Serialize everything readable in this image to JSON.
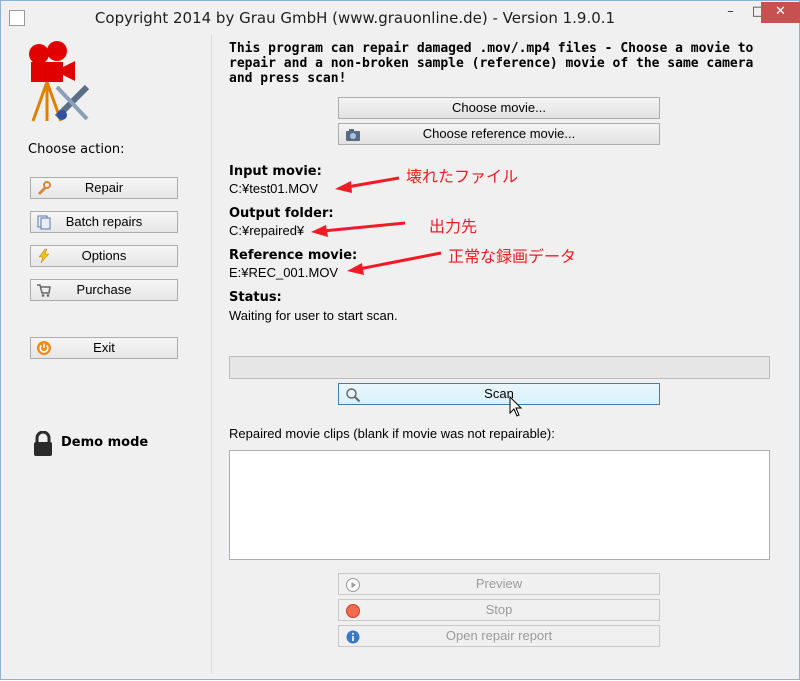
{
  "window": {
    "title": "Copyright 2014 by Grau GmbH (www.grauonline.de) - Version 1.9.0.1",
    "controls": {
      "minimize": "–",
      "maximize": "□",
      "close": "✕"
    }
  },
  "sidebar": {
    "choose_label": "Choose action:",
    "items": [
      {
        "label": "Repair",
        "icon": "wrench-icon"
      },
      {
        "label": "Batch repairs",
        "icon": "pages-icon"
      },
      {
        "label": "Options",
        "icon": "lightning-icon"
      },
      {
        "label": "Purchase",
        "icon": "cart-icon"
      },
      {
        "label": "Exit",
        "icon": "power-icon"
      }
    ],
    "demo_mode": "Demo mode"
  },
  "main": {
    "intro": "This program can repair damaged .mov/.mp4 files - Choose a movie to repair and a non-broken sample (reference) movie of the same camera and press scan!",
    "choose_movie": "Choose movie...",
    "choose_reference": "Choose reference movie...",
    "input_movie_label": "Input movie:",
    "input_movie_value": "C:¥test01.MOV",
    "output_folder_label": "Output folder:",
    "output_folder_value": "C:¥repaired¥",
    "reference_movie_label": "Reference movie:",
    "reference_movie_value": "E:¥REC_001.MOV",
    "status_label": "Status:",
    "status_value": "Waiting for user to start scan.",
    "progress": 0,
    "scan": "Scan",
    "clips_label": "Repaired movie clips (blank if movie was not repairable):",
    "preview": "Preview",
    "stop": "Stop",
    "open_report": "Open repair report"
  },
  "annotations": {
    "broken_file": "壊れたファイル",
    "output_dest": "出力先",
    "normal_recording": "正常な録画データ"
  },
  "colors": {
    "annotation": "#ee1c25",
    "accent": "#3c7fb1",
    "close_button": "#c75050"
  }
}
